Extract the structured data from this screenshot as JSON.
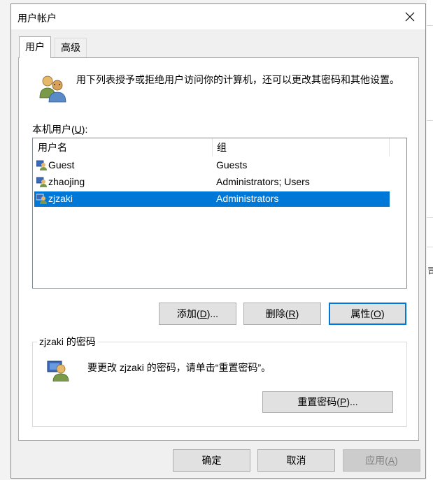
{
  "dialog": {
    "title": "用户帐户",
    "close_glyph": "✕"
  },
  "tabs": [
    {
      "label": "用户",
      "active": true
    },
    {
      "label": "高级",
      "active": false
    }
  ],
  "users_tab": {
    "description": "用下列表授予或拒绝用户访问你的计算机，还可以更改其密码和其他设置。",
    "list_label_prefix": "本机用户(",
    "list_label_key": "U",
    "list_label_suffix": "):",
    "columns": [
      "用户名",
      "组"
    ],
    "users": [
      {
        "name": "Guest",
        "group": "Guests",
        "selected": false
      },
      {
        "name": "zhaojing",
        "group": "Administrators; Users",
        "selected": false
      },
      {
        "name": "zjzaki",
        "group": "Administrators",
        "selected": true
      }
    ],
    "buttons": {
      "add": {
        "prefix": "添加(",
        "key": "D",
        "suffix": ")..."
      },
      "remove": {
        "prefix": "删除(",
        "key": "R",
        "suffix": ")"
      },
      "properties": {
        "prefix": "属性(",
        "key": "O",
        "suffix": ")"
      }
    },
    "password_group": {
      "title": "zjzaki 的密码",
      "text": "要更改 zjzaki 的密码，请单击“重置密码”。",
      "reset": {
        "prefix": "重置密码(",
        "key": "P",
        "suffix": ")..."
      }
    }
  },
  "footer": {
    "ok": "确定",
    "cancel": "取消",
    "apply": {
      "prefix": "应用(",
      "key": "A",
      "suffix": ")"
    }
  },
  "background": {
    "fragment": "司"
  },
  "colors": {
    "selection": "#0078d7",
    "dialog_bg": "#f0f0f0",
    "panel_bg": "#ffffff"
  }
}
